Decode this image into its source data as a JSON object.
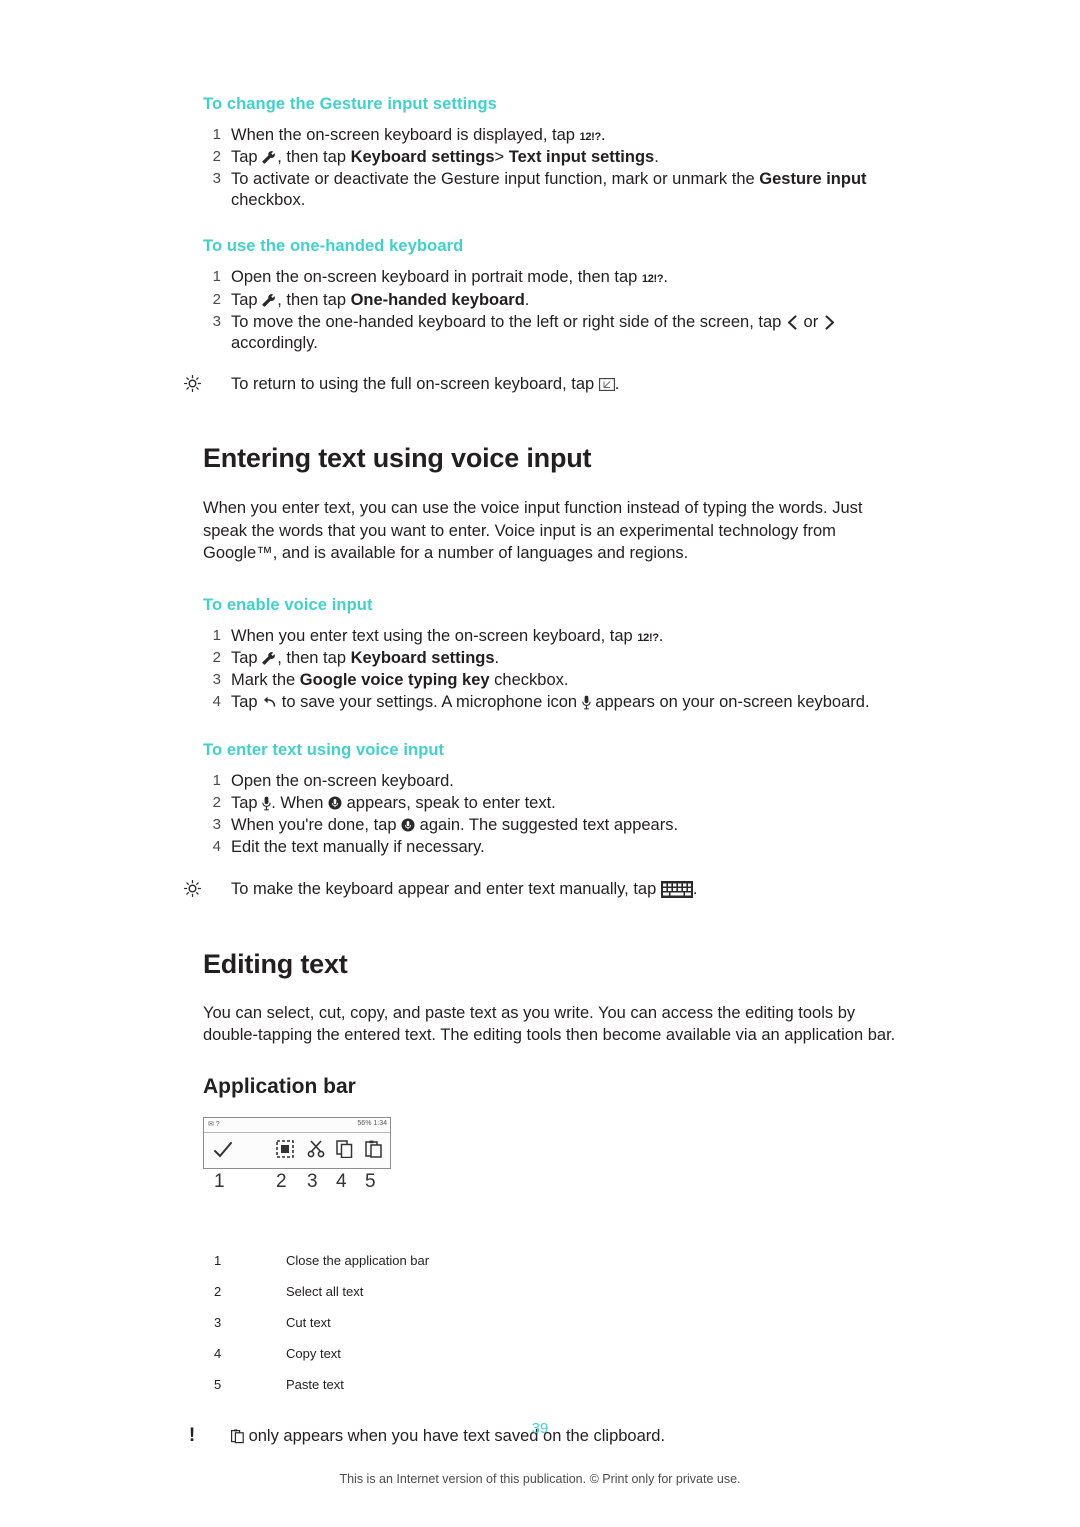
{
  "sections": [
    {
      "heading": "To change the Gesture input settings",
      "steps": [
        "When the on-screen keyboard is displayed, tap ",
        "Tap , then tap Keyboard settings> Text input settings.",
        "To activate or deactivate the Gesture input function, mark or unmark the Gesture input checkbox."
      ]
    },
    {
      "heading": "To use the one-handed keyboard",
      "steps": [
        "Open the on-screen keyboard in portrait mode, then tap",
        "Tap , then tap One-handed keyboard.",
        "To move the one-handed keyboard to the left or right side of the screen, tap or accordingly."
      ],
      "tip": "To return to using the full on-screen keyboard, tap ."
    }
  ],
  "chapter1": {
    "title": "Entering text using voice input",
    "body": "When you enter text, you can use the voice input function instead of typing the words. Just speak the words that you want to enter. Voice input is an experimental technology from Google™, and is available for a number of languages and regions."
  },
  "enable_voice": {
    "heading": "To enable voice input",
    "step1_a": "When you enter text using the on-screen keyboard, tap ",
    "step1_dot": ".",
    "step2_a": "Tap ",
    "step2_b": ", then tap ",
    "step2_bold": "Keyboard settings",
    "step2_end": ".",
    "step3_a": "Mark the ",
    "step3_bold": "Google voice typing key",
    "step3_b": " checkbox.",
    "step4_a": "Tap ",
    "step4_b": " to save your settings. A microphone icon ",
    "step4_c": " appears on your on-screen keyboard."
  },
  "enter_voice": {
    "heading": "To enter text using voice input",
    "step1": "Open the on-screen keyboard.",
    "step2_a": "Tap ",
    "step2_b": ". When ",
    "step2_c": " appears, speak to enter text.",
    "step3_a": "When you're done, tap ",
    "step3_b": " again. The suggested text appears.",
    "step4": "Edit the text manually if necessary.",
    "tip_a": "To make the keyboard appear and enter text manually, tap ",
    "tip_b": "."
  },
  "chapter2": {
    "title": "Editing text",
    "body": "You can select, cut, copy, and paste text as you write. You can access the editing tools by double-tapping the entered text. The editing tools then become available via an application bar.",
    "subhead": "Application bar"
  },
  "figure": {
    "status_left": "✉ ?",
    "status_right": "56%  1:34",
    "callouts": [
      "1",
      "2",
      "3",
      "4",
      "5"
    ],
    "icons": [
      "check-icon",
      "select-all-icon",
      "cut-icon",
      "copy-icon",
      "paste-icon"
    ]
  },
  "legend": {
    "rows": [
      {
        "n": "1",
        "text": "Close the application bar"
      },
      {
        "n": "2",
        "text": "Select all text"
      },
      {
        "n": "3",
        "text": "Cut text"
      },
      {
        "n": "4",
        "text": "Copy text"
      },
      {
        "n": "5",
        "text": "Paste text"
      }
    ]
  },
  "note": {
    "text": " only appears when you have text saved on the clipboard."
  },
  "page_number": "39",
  "footer": "This is an Internet version of this publication. © Print only for private use.",
  "colors": {
    "accent": "#3fd2cd",
    "text": "#231f20"
  }
}
